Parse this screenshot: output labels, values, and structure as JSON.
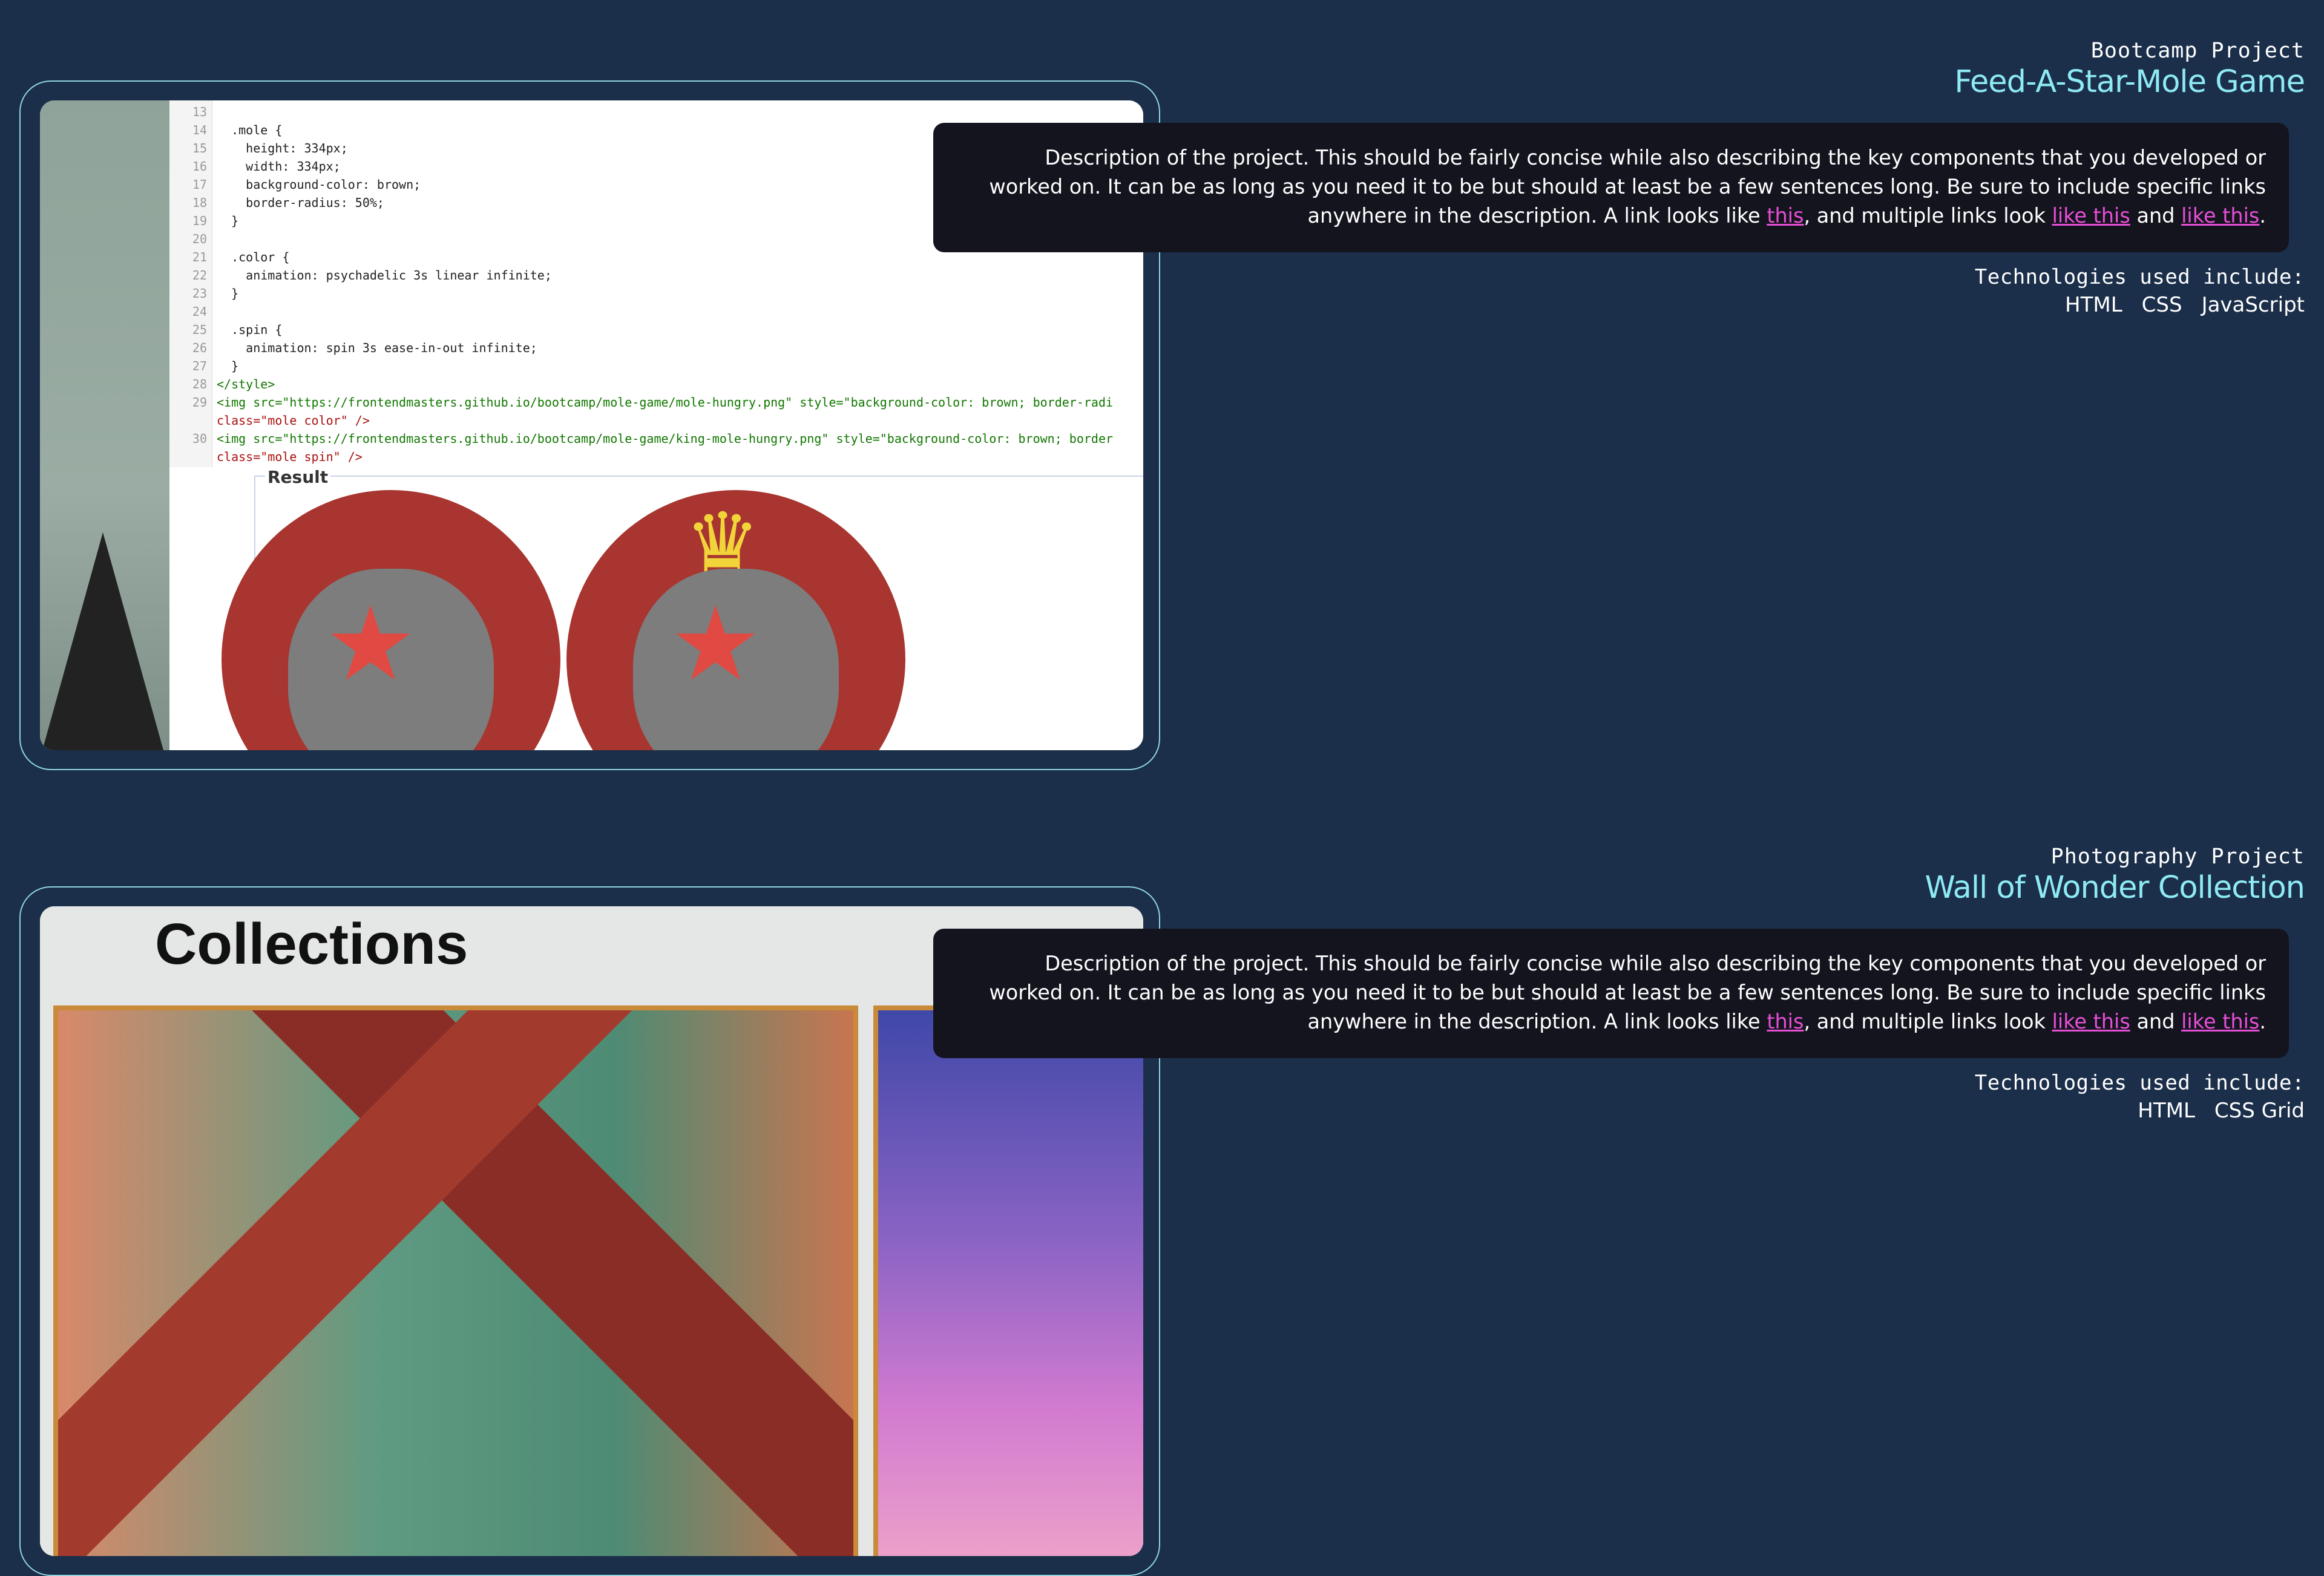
{
  "projects": [
    {
      "overline": "Bootcamp Project",
      "title": "Feed-A-Star-Mole Game",
      "description": {
        "text_before": "Description of the project. This should be fairly concise while also describing the key components that you developed or worked on. It can be as long as you need it to be but should at least be a few sentences long. Be sure to include specific links anywhere in the description. A link looks like ",
        "link1": "this",
        "text_mid": ", and multiple links look ",
        "link2": "like this",
        "text_and": " and ",
        "link3": "like this",
        "text_end": "."
      },
      "tech_heading": "Technologies used include:",
      "technologies": [
        "HTML",
        "CSS",
        "JavaScript"
      ],
      "screenshot": {
        "result_label": "Result",
        "code_lines": [
          {
            "n": "13",
            "t": ""
          },
          {
            "n": "14",
            "t": "  .mole {"
          },
          {
            "n": "15",
            "t": "    height: 334px;"
          },
          {
            "n": "16",
            "t": "    width: 334px;"
          },
          {
            "n": "17",
            "t": "    background-color: brown;"
          },
          {
            "n": "18",
            "t": "    border-radius: 50%;"
          },
          {
            "n": "19",
            "t": "  }"
          },
          {
            "n": "20",
            "t": ""
          },
          {
            "n": "21",
            "t": "  .color {"
          },
          {
            "n": "22",
            "t": "    animation: psychadelic 3s linear infinite;"
          },
          {
            "n": "23",
            "t": "  }"
          },
          {
            "n": "24",
            "t": ""
          },
          {
            "n": "25",
            "t": "  .spin {"
          },
          {
            "n": "26",
            "t": "    animation: spin 3s ease-in-out infinite;"
          },
          {
            "n": "27",
            "t": "  }"
          },
          {
            "n": "28",
            "t": "</style>"
          },
          {
            "n": "29",
            "t": "<img src=\"https://frontendmasters.github.io/bootcamp/mole-game/mole-hungry.png\" style=\"background-color: brown; border-radi"
          },
          {
            "n": "",
            "t": "class=\"mole color\" />"
          },
          {
            "n": "30",
            "t": "<img src=\"https://frontendmasters.github.io/bootcamp/mole-game/king-mole-hungry.png\" style=\"background-color: brown; border"
          },
          {
            "n": "",
            "t": "class=\"mole spin\" />"
          }
        ]
      }
    },
    {
      "overline": "Photography Project",
      "title": "Wall of Wonder Collection",
      "description": {
        "text_before": "Description of the project. This should be fairly concise while also describing the key components that you developed or worked on. It can be as long as you need it to be but should at least be a few sentences long. Be sure to include specific links anywhere in the description. A link looks like ",
        "link1": "this",
        "text_mid": ", and multiple links look ",
        "link2": "like this",
        "text_and": " and ",
        "link3": "like this",
        "text_end": "."
      },
      "tech_heading": "Technologies used include:",
      "technologies": [
        "HTML",
        "CSS Grid"
      ],
      "screenshot": {
        "heading": "Collections"
      }
    }
  ],
  "colors": {
    "background": "#1b2f4a",
    "title": "#8eeaf4",
    "link": "#e64fd6",
    "card": "#14141f"
  }
}
